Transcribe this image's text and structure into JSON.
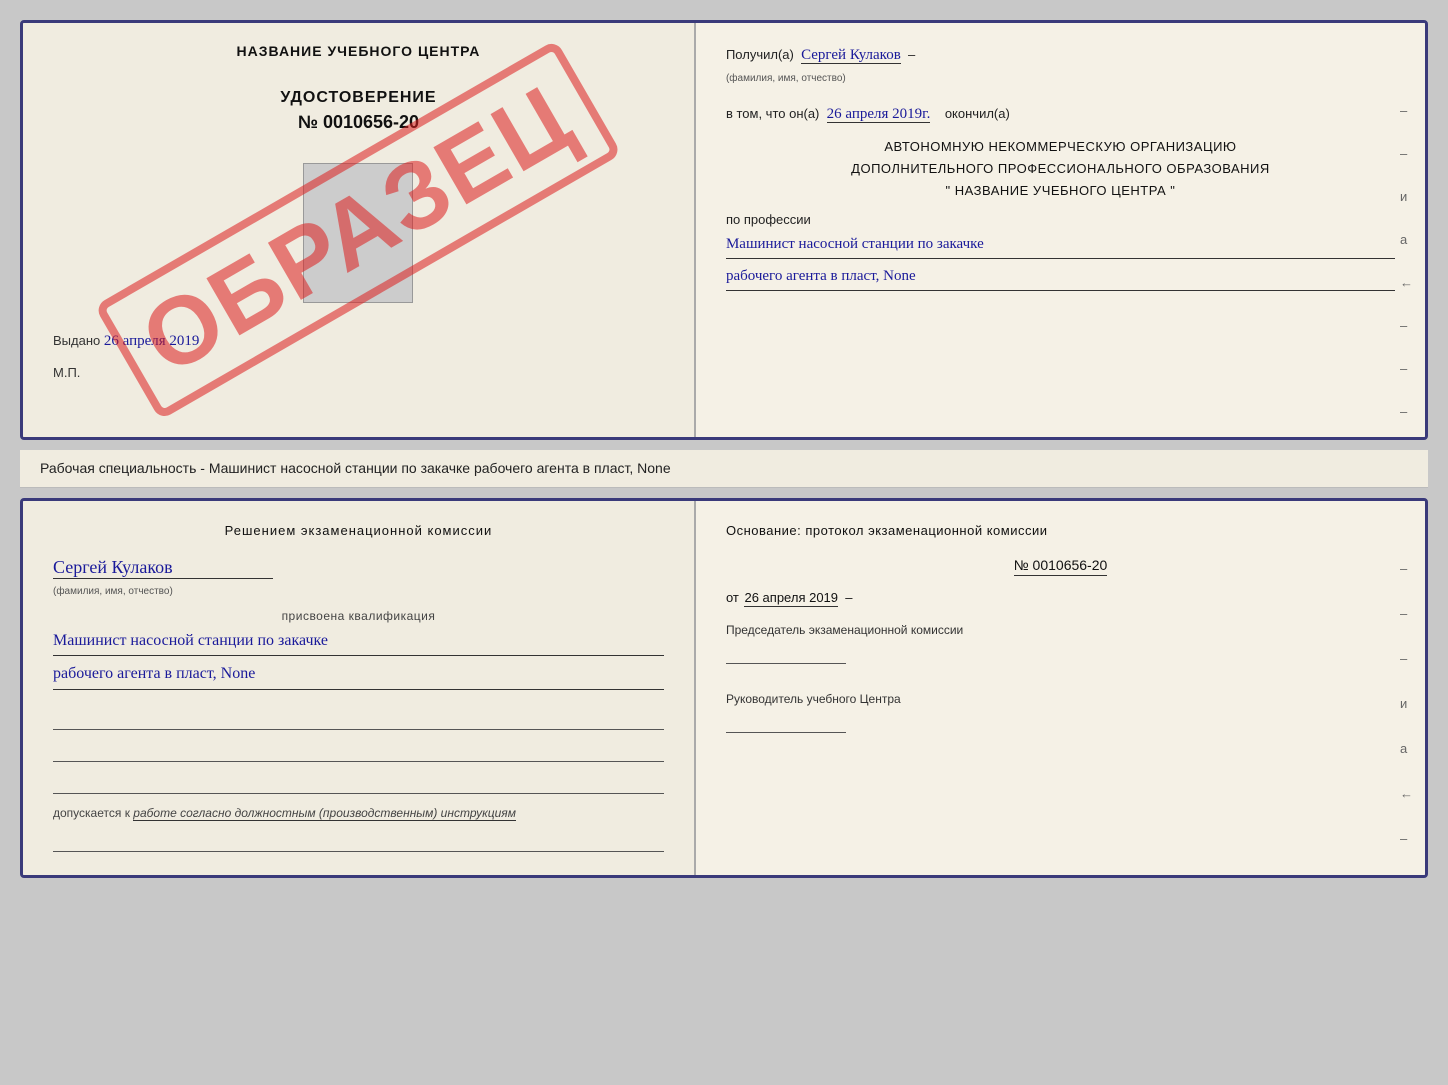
{
  "topDoc": {
    "left": {
      "centerTitle": "НАЗВАНИЕ УЧЕБНОГО ЦЕНТРА",
      "certTitle": "УДОСТОВЕРЕНИЕ",
      "certNumber": "№ 0010656-20",
      "watermark": "ОБРАЗЕЦ",
      "issuedLabel": "Выдано",
      "issuedDate": "26 апреля 2019",
      "mpLabel": "М.П."
    },
    "right": {
      "receivedLabel": "Получил(а)",
      "recipientName": "Сергей Кулаков",
      "recipientSubLabel": "(фамилия, имя, отчество)",
      "dashSeparator": "–",
      "dateLabel": "в том, что он(а)",
      "dateValue": "26 апреля 2019г.",
      "finishedLabel": "окончил(а)",
      "orgLine1": "АВТОНОМНУЮ НЕКОММЕРЧЕСКУЮ ОРГАНИЗАЦИЮ",
      "orgLine2": "ДОПОЛНИТЕЛЬНОГО ПРОФЕССИОНАЛЬНОГО ОБРАЗОВАНИЯ",
      "orgName": "\" НАЗВАНИЕ УЧЕБНОГО ЦЕНТРА \"",
      "professionLabel": "по профессии",
      "professionLine1": "Машинист насосной станции по закачке",
      "professionLine2": "рабочего агента в пласт, None",
      "dashes": [
        "–",
        "–",
        "и",
        "а",
        "←",
        "–",
        "–",
        "–"
      ]
    }
  },
  "descriptionLine": "Рабочая специальность - Машинист насосной станции по закачке рабочего агента в пласт, None",
  "bottomDoc": {
    "left": {
      "commissionTitle": "Решением экзаменационной комиссии",
      "personName": "Сергей Кулаков",
      "personSubLabel": "(фамилия, имя, отчество)",
      "assignedLabel": "присвоена квалификация",
      "qualLine1": "Машинист насосной станции по закачке",
      "qualLine2": "рабочего агента в пласт, None",
      "admittedLabel": "допускается к",
      "admittedValue": "работе согласно должностным (производственным) инструкциям"
    },
    "right": {
      "basisTitle": "Основание: протокол экзаменационной комиссии",
      "protocolNumber": "№ 0010656-20",
      "protocolDatePrefix": "от",
      "protocolDate": "26 апреля 2019",
      "chairmanLabel": "Председатель экзаменационной комиссии",
      "headLabel": "Руководитель учебного Центра",
      "dashes": [
        "–",
        "–",
        "–",
        "и",
        "а",
        "←",
        "–",
        "–",
        "–",
        "–"
      ]
    }
  }
}
